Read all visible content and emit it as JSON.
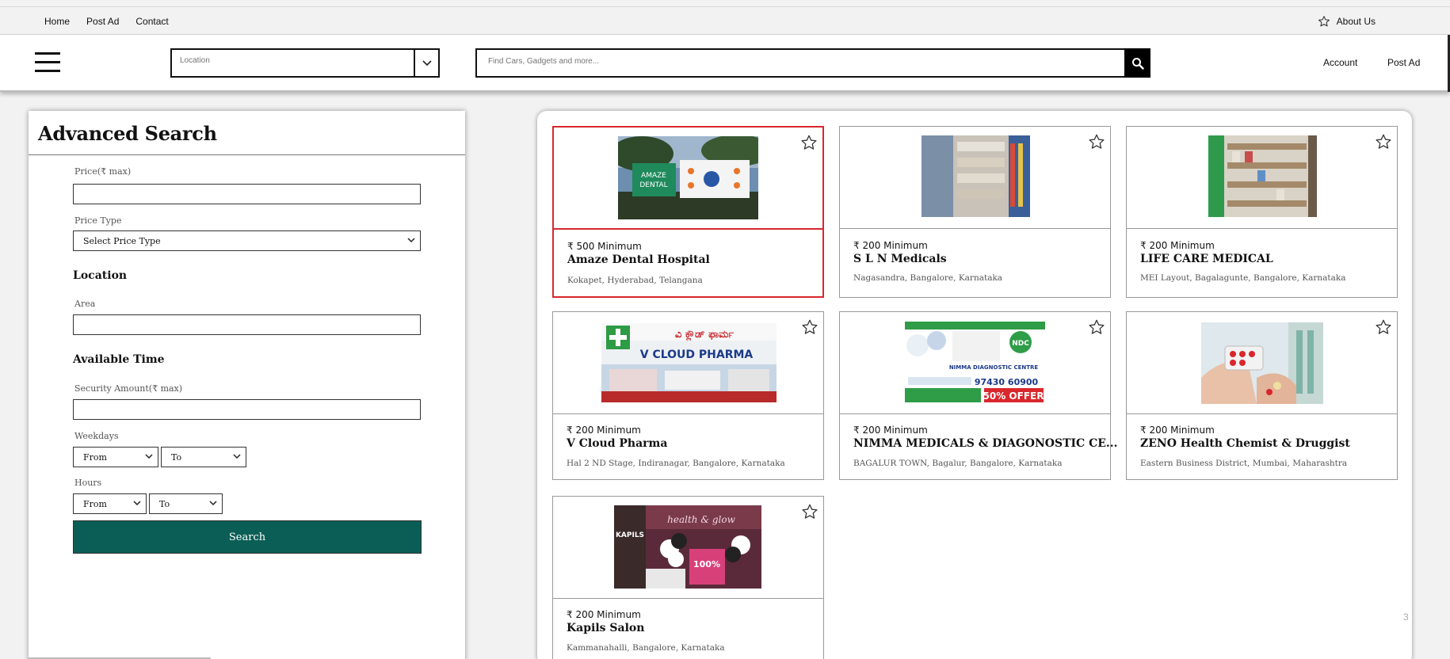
{
  "topbar": {
    "nav": [
      "Home",
      "Post Ad",
      "Contact"
    ],
    "about": "About Us",
    "about_icon": "star-outline-icon"
  },
  "header": {
    "menu_icon": "hamburger-menu-icon",
    "location_placeholder": "Location",
    "search_placeholder": "Find Cars, Gadgets and more...",
    "search_icon": "magnifier-icon",
    "account": "Account",
    "post_ad": "Post Ad"
  },
  "sidebar": {
    "title": "Advanced Search",
    "price_label": "Price(₹ max)",
    "price_type_label": "Price Type",
    "price_type_value": "Select Price Type",
    "location_heading": "Location",
    "area_label": "Area",
    "available_time_heading": "Available Time",
    "security_label": "Security Amount(₹ max)",
    "weekdays_label": "Weekdays",
    "weekdays_from": "From",
    "weekdays_to": "To",
    "hours_label": "Hours",
    "hours_from": "From",
    "hours_to": "To",
    "search_button": "Search"
  },
  "listings": [
    {
      "price": "₹ 500 Minimum",
      "title": "Amaze Dental Hospital",
      "address": "Kokapet, Hyderabad, Telangana",
      "selected": true
    },
    {
      "price": "₹ 200 Minimum",
      "title": "S L N Medicals",
      "address": "Nagasandra, Bangalore, Karnataka"
    },
    {
      "price": "₹ 200 Minimum",
      "title": "LIFE CARE MEDICAL",
      "address": "MEI Layout, Bagalagunte, Bangalore, Karnataka"
    },
    {
      "price": "₹ 200 Minimum",
      "title": "V Cloud Pharma",
      "address": "Hal 2 ND Stage, Indiranagar, Bangalore, Karnataka"
    },
    {
      "price": "₹ 200 Minimum",
      "title": "NIMMA MEDICALS & DIAGONOSTIC CE...",
      "address": "BAGALUR TOWN, Bagalur, Bangalore, Karnataka"
    },
    {
      "price": "₹ 200 Minimum",
      "title": "ZENO Health Chemist & Druggist",
      "address": "Eastern Business District, Mumbai, Maharashtra"
    },
    {
      "price": "₹ 200 Minimum",
      "title": "Kapils Salon",
      "address": "Kammanahalli, Bangalore, Karnataka"
    }
  ],
  "page_number": "3",
  "colors": {
    "accent_button": "#0b5e55",
    "selected_border": "#d8272d"
  }
}
